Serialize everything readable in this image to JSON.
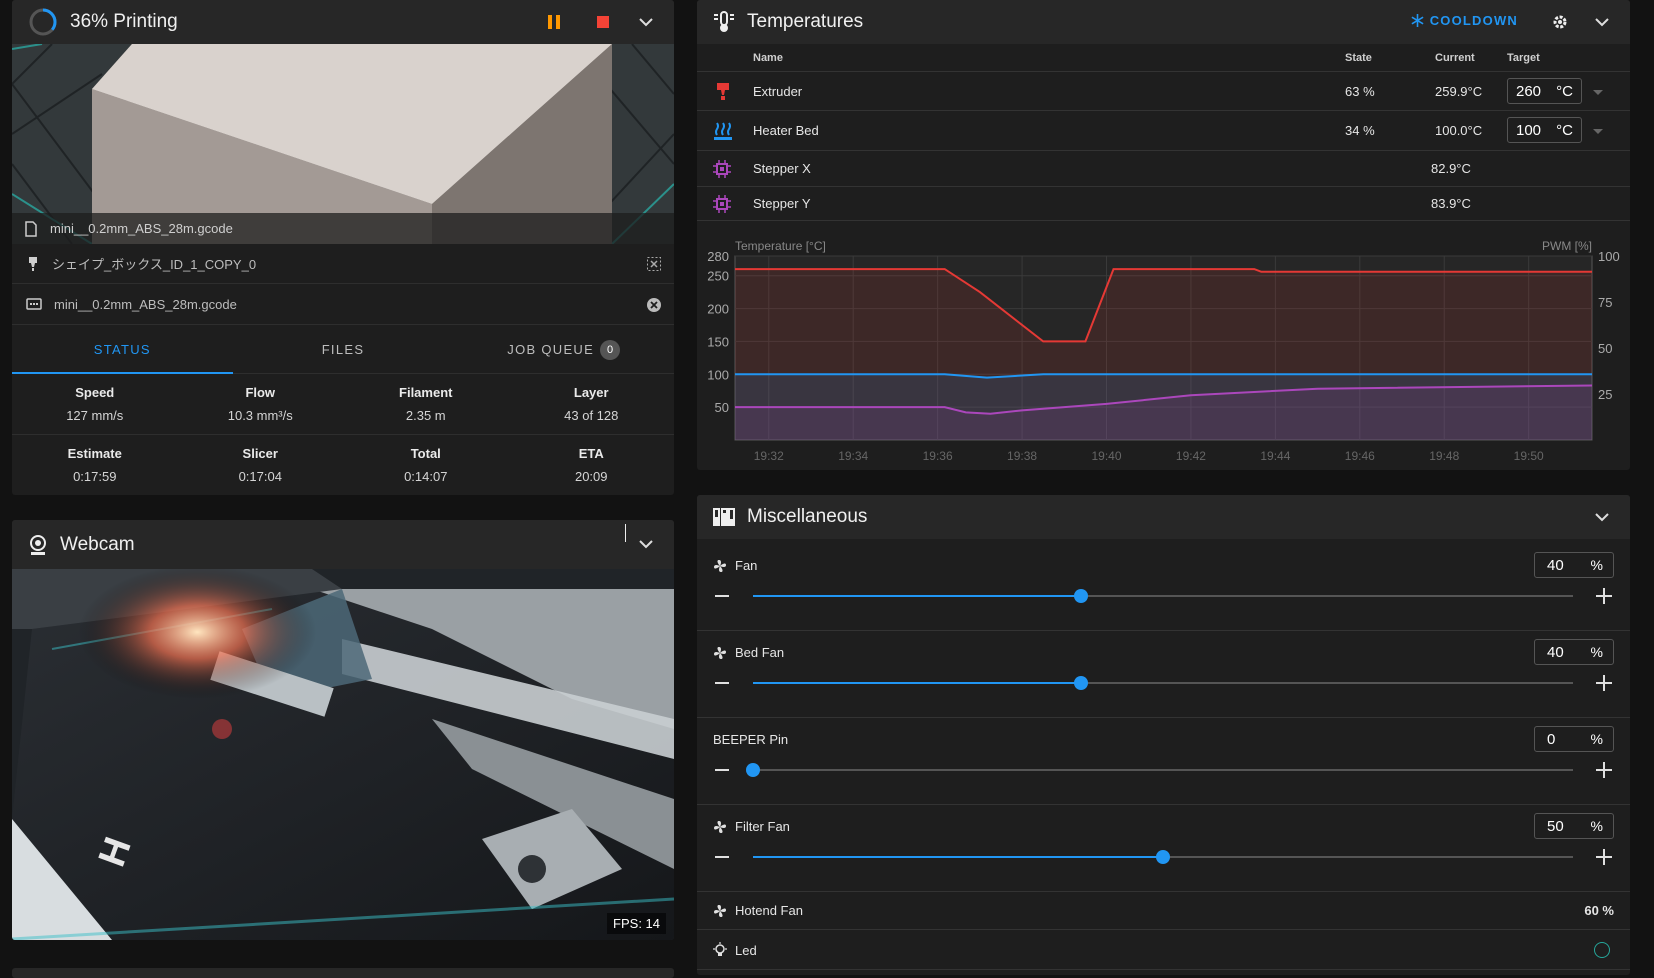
{
  "status": {
    "title": "36% Printing",
    "progress": 0.36,
    "thumbnail_file": "mini__0.2mm_ABS_28m.gcode",
    "object_name": "シェイプ_ボックス_ID_1_COPY_0",
    "gcode_file": "mini__0.2mm_ABS_28m.gcode",
    "tabs": [
      {
        "label": "STATUS",
        "active": true
      },
      {
        "label": "FILES",
        "active": false
      },
      {
        "label": "JOB QUEUE",
        "badge": "0",
        "active": false
      }
    ],
    "stats_row1": [
      {
        "label": "Speed",
        "value": "127 mm/s"
      },
      {
        "label": "Flow",
        "value": "10.3 mm³/s"
      },
      {
        "label": "Filament",
        "value": "2.35 m"
      },
      {
        "label": "Layer",
        "value": "43 of 128"
      }
    ],
    "stats_row2": [
      {
        "label": "Estimate",
        "value": "0:17:59"
      },
      {
        "label": "Slicer",
        "value": "0:17:04"
      },
      {
        "label": "Total",
        "value": "0:14:07"
      },
      {
        "label": "ETA",
        "value": "20:09"
      }
    ]
  },
  "webcam": {
    "title": "Webcam",
    "fps": "FPS: 14"
  },
  "temps": {
    "title": "Temperatures",
    "cooldown_label": "COOLDOWN",
    "columns": {
      "name": "Name",
      "state": "State",
      "current": "Current",
      "target": "Target"
    },
    "rows": [
      {
        "name": "Extruder",
        "state": "63 %",
        "current": "259.9°C",
        "target": "260",
        "unit": "°C",
        "icon": "extruder-icon",
        "color": "#e53935"
      },
      {
        "name": "Heater Bed",
        "state": "34 %",
        "current": "100.0°C",
        "target": "100",
        "unit": "°C",
        "icon": "heater-bed-icon",
        "color": "#2196f3"
      },
      {
        "name": "Stepper X",
        "state": "",
        "current": "82.9°C",
        "icon": "chip-icon",
        "color": "#ab47bc"
      },
      {
        "name": "Stepper Y",
        "state": "",
        "current": "83.9°C",
        "icon": "chip-icon",
        "color": "#ab47bc"
      }
    ]
  },
  "chart_data": {
    "type": "line",
    "ylabel": "Temperature [°C]",
    "y2label": "PWM [%]",
    "ylim": [
      0,
      280
    ],
    "y2lim": [
      0,
      100
    ],
    "yticks": [
      "280",
      "250",
      "200",
      "150",
      "100",
      "50"
    ],
    "y2ticks": [
      "100",
      "75",
      "50",
      "25"
    ],
    "xticks": [
      "19:32",
      "19:34",
      "19:36",
      "19:38",
      "19:40",
      "19:42",
      "19:44",
      "19:46",
      "19:48",
      "19:50"
    ],
    "series": [
      {
        "name": "Extruder",
        "color": "#e53935",
        "points": [
          [
            "19:31:12",
            260
          ],
          [
            "19:36:10",
            260
          ],
          [
            "19:37:00",
            225
          ],
          [
            "19:38:30",
            150
          ],
          [
            "19:39:30",
            150
          ],
          [
            "19:40:10",
            260
          ],
          [
            "19:43:30",
            260
          ],
          [
            "19:43:40",
            256
          ],
          [
            "19:51:30",
            256
          ]
        ]
      },
      {
        "name": "Heater Bed",
        "color": "#2196f3",
        "points": [
          [
            "19:31:12",
            100
          ],
          [
            "19:36:10",
            100
          ],
          [
            "19:37:10",
            95
          ],
          [
            "19:38:30",
            100
          ],
          [
            "19:51:30",
            100
          ]
        ]
      },
      {
        "name": "Stepper X",
        "color": "#ab47bc",
        "points": [
          [
            "19:31:12",
            50
          ],
          [
            "19:36:10",
            50
          ],
          [
            "19:36:40",
            42
          ],
          [
            "19:37:15",
            40
          ],
          [
            "19:38:00",
            45
          ],
          [
            "19:40:00",
            55
          ],
          [
            "19:42:00",
            68
          ],
          [
            "19:45:00",
            78
          ],
          [
            "19:51:30",
            83
          ]
        ]
      }
    ]
  },
  "misc": {
    "title": "Miscellaneous",
    "fans": [
      {
        "name": "Fan",
        "value": "40",
        "unit": "%",
        "level": 0.4,
        "icon": "fan-icon"
      },
      {
        "name": "Bed Fan",
        "value": "40",
        "unit": "%",
        "level": 0.4,
        "icon": "fan-icon"
      },
      {
        "name": "BEEPER Pin",
        "value": "0",
        "unit": "%",
        "level": 0.0,
        "icon": ""
      },
      {
        "name": "Filter Fan",
        "value": "50",
        "unit": "%",
        "level": 0.5,
        "icon": "fan-icon"
      }
    ],
    "hotend_fan": {
      "name": "Hotend Fan",
      "value": "60 %"
    },
    "led": {
      "name": "Led"
    }
  }
}
